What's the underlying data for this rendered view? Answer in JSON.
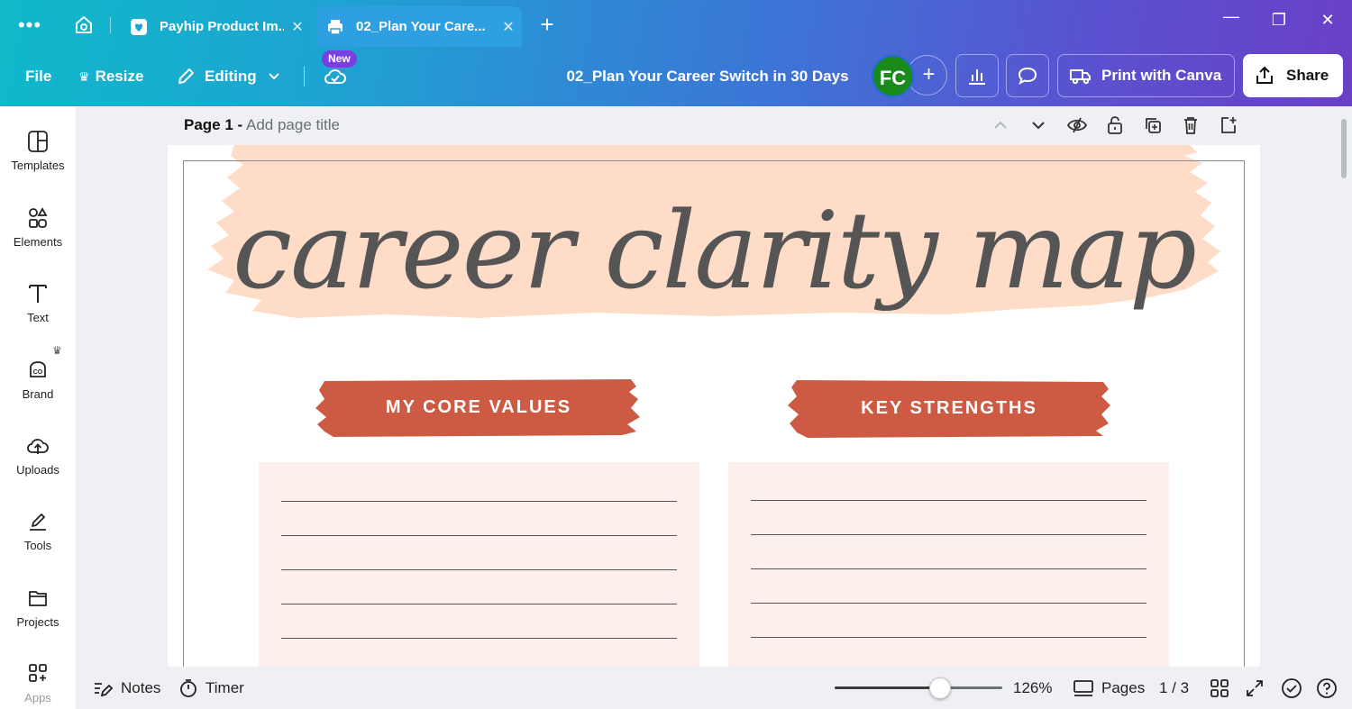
{
  "browser": {
    "menu_glyph": "•••",
    "tabs": [
      {
        "label": "Payhip Product Im...",
        "icon": "heart-shop-icon",
        "close": "✕"
      },
      {
        "label": "02_Plan Your Care...",
        "icon": "printer-icon",
        "close": "✕"
      }
    ],
    "new_tab_glyph": "+",
    "window_controls": {
      "minimize": "—",
      "restore": "❐",
      "close": "✕"
    }
  },
  "toolbar": {
    "file_label": "File",
    "resize_label": "Resize",
    "editing_label": "Editing",
    "new_badge": "New",
    "document_title": "02_Plan Your Career Switch in 30 Days",
    "avatar_initials": "FC",
    "add_collaborator_glyph": "+",
    "print_label": "Print with Canva",
    "share_label": "Share"
  },
  "sidebar": {
    "items": [
      {
        "label": "Templates",
        "icon": "templates-icon"
      },
      {
        "label": "Elements",
        "icon": "elements-icon"
      },
      {
        "label": "Text",
        "icon": "text-icon"
      },
      {
        "label": "Brand",
        "icon": "brand-icon"
      },
      {
        "label": "Uploads",
        "icon": "uploads-icon"
      },
      {
        "label": "Tools",
        "icon": "tools-icon"
      },
      {
        "label": "Projects",
        "icon": "projects-icon"
      },
      {
        "label": "Apps",
        "icon": "apps-icon"
      }
    ],
    "premium_glyph": "♛"
  },
  "page": {
    "number_label": "Page 1 -",
    "title_placeholder": "Add page title"
  },
  "design": {
    "title": "career clarity map",
    "left_heading": "MY CORE VALUES",
    "right_heading": "KEY STRENGTHS",
    "colors": {
      "title_text": "#555555",
      "brush_peach": "#ffdcc7",
      "badge_red": "#cd5a43",
      "box_pink": "#fdefec"
    }
  },
  "bottombar": {
    "notes_label": "Notes",
    "timer_label": "Timer",
    "zoom_percent": 0.63,
    "zoom_label": "126%",
    "pages_label": "Pages",
    "page_counter": "1 / 3"
  }
}
